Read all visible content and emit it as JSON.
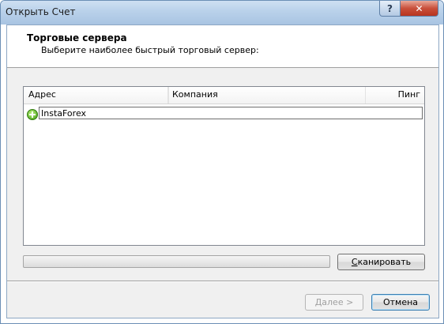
{
  "window": {
    "title": "Открыть Счет",
    "help_label": "?",
    "close_label": "✕"
  },
  "header": {
    "title": "Торговые сервера",
    "subtitle": "Выберите наиболее быстрый торговый сервер:"
  },
  "server_list": {
    "columns": [
      "Адрес",
      "Компания",
      "Пинг"
    ],
    "input_value": "InstaForex",
    "row_icon": "add-icon"
  },
  "scan": {
    "progress": 0,
    "scan_label_first": "С",
    "scan_label_rest": "канировать"
  },
  "footer": {
    "next_label": "Далее >",
    "next_first": "Д",
    "next_rest": "алее >",
    "cancel_label": "Отмена"
  }
}
